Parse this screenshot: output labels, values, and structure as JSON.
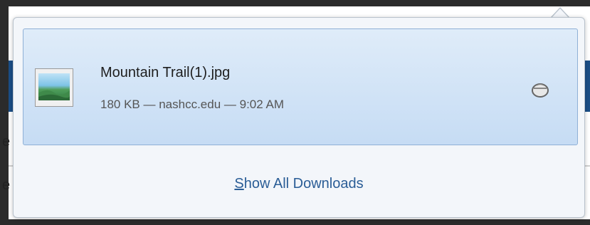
{
  "page": {
    "edge_glyphs": [
      "e",
      "e"
    ]
  },
  "downloads": {
    "items": [
      {
        "file_name": "Mountain Trail(1).jpg",
        "meta": "180 KB — nashcc.edu — 9:02 AM",
        "thumbnail_icon": "image-file-icon",
        "action_icon": "open-folder-icon"
      }
    ],
    "show_all": {
      "accesskey": "S",
      "rest": "how All Downloads"
    }
  }
}
